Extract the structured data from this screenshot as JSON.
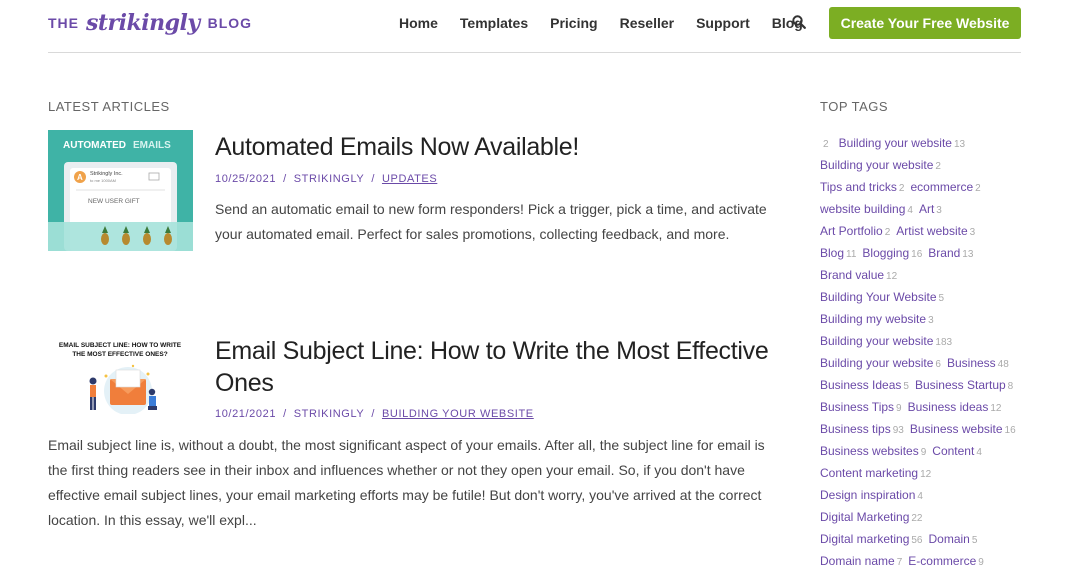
{
  "header": {
    "logo_the": "THE",
    "logo_brand": "strikingly",
    "logo_blog": "BLOG",
    "nav": [
      "Home",
      "Templates",
      "Pricing",
      "Reseller",
      "Support",
      "Blog"
    ],
    "cta": "Create Your Free Website"
  },
  "main": {
    "section_title": "LATEST ARTICLES",
    "articles": [
      {
        "title": "Automated Emails Now Available!",
        "date": "10/25/2021",
        "author": "STRIKINGLY",
        "category": "UPDATES",
        "excerpt": "Send an automatic email to new form responders! Pick a trigger, pick a time, and activate your automated email. Perfect for sales promotions, collecting feedback, and more.",
        "thumb": {
          "heading_a": "AUTOMATED",
          "heading_b": "EMAILS",
          "sender": "Strikingly Inc.",
          "sender_sub": "to me 1000AM",
          "avatar_letter": "A",
          "gift": "NEW USER GIFT"
        }
      },
      {
        "title_line1": "Email Subject Line: How to Write the Most Effective",
        "title_line2": "Ones",
        "date": "10/21/2021",
        "author": "STRIKINGLY",
        "category": "BUILDING YOUR WEBSITE",
        "excerpt": "Email subject line is, without a doubt, the most significant aspect of your emails. After all, the subject line for email is the first thing readers see in their inbox and influences whether or not they open your email. So, if you don't have effective email subject lines, your email marketing efforts may be futile! But don't worry, you've arrived at the correct location. In this essay, we'll expl...",
        "thumb": {
          "line1": "EMAIL SUBJECT LINE: HOW TO WRITE",
          "line2": "THE MOST EFFECTIVE ONES?"
        }
      }
    ]
  },
  "sidebar": {
    "title": "TOP TAGS",
    "tag_lines": [
      [
        {
          "name": "",
          "count": "2"
        },
        {
          "name": "Building your website",
          "count": "13"
        }
      ],
      [
        {
          "name": "Building your website",
          "count": "2"
        }
      ],
      [
        {
          "name": "Tips and tricks",
          "count": "2"
        },
        {
          "name": "ecommerce",
          "count": "2"
        }
      ],
      [
        {
          "name": "website building",
          "count": "4"
        },
        {
          "name": "Art",
          "count": "3"
        }
      ],
      [
        {
          "name": "Art Portfolio",
          "count": "2"
        },
        {
          "name": "Artist website",
          "count": "3"
        }
      ],
      [
        {
          "name": "Blog",
          "count": "11"
        },
        {
          "name": "Blogging",
          "count": "16"
        },
        {
          "name": "Brand",
          "count": "13"
        }
      ],
      [
        {
          "name": "Brand value",
          "count": "12"
        }
      ],
      [
        {
          "name": "Building Your Website",
          "count": "5"
        }
      ],
      [
        {
          "name": "Building my website",
          "count": "3"
        }
      ],
      [
        {
          "name": "Building your website",
          "count": "183"
        }
      ],
      [
        {
          "name": "Building your website",
          "count": "6"
        },
        {
          "name": "Business",
          "count": "48"
        }
      ],
      [
        {
          "name": "Business Ideas",
          "count": "5"
        },
        {
          "name": "Business Startup",
          "count": "8"
        }
      ],
      [
        {
          "name": "Business Tips",
          "count": "9"
        },
        {
          "name": "Business ideas",
          "count": "12"
        }
      ],
      [
        {
          "name": "Business tips",
          "count": "93"
        },
        {
          "name": "Business website",
          "count": "16"
        }
      ],
      [
        {
          "name": "Business websites",
          "count": "9"
        },
        {
          "name": "Content",
          "count": "4"
        }
      ],
      [
        {
          "name": "Content marketing",
          "count": "12"
        }
      ],
      [
        {
          "name": "Design inspiration",
          "count": "4"
        }
      ],
      [
        {
          "name": "Digital Marketing",
          "count": "22"
        }
      ],
      [
        {
          "name": "Digital marketing",
          "count": "56"
        },
        {
          "name": "Domain",
          "count": "5"
        }
      ],
      [
        {
          "name": "Domain name",
          "count": "7"
        },
        {
          "name": "E-commerce",
          "count": "9"
        }
      ]
    ]
  },
  "colors": {
    "brand_purple": "#6b4aa8",
    "cta_green": "#7cae23",
    "thumb_teal": "#3fb3a6"
  }
}
